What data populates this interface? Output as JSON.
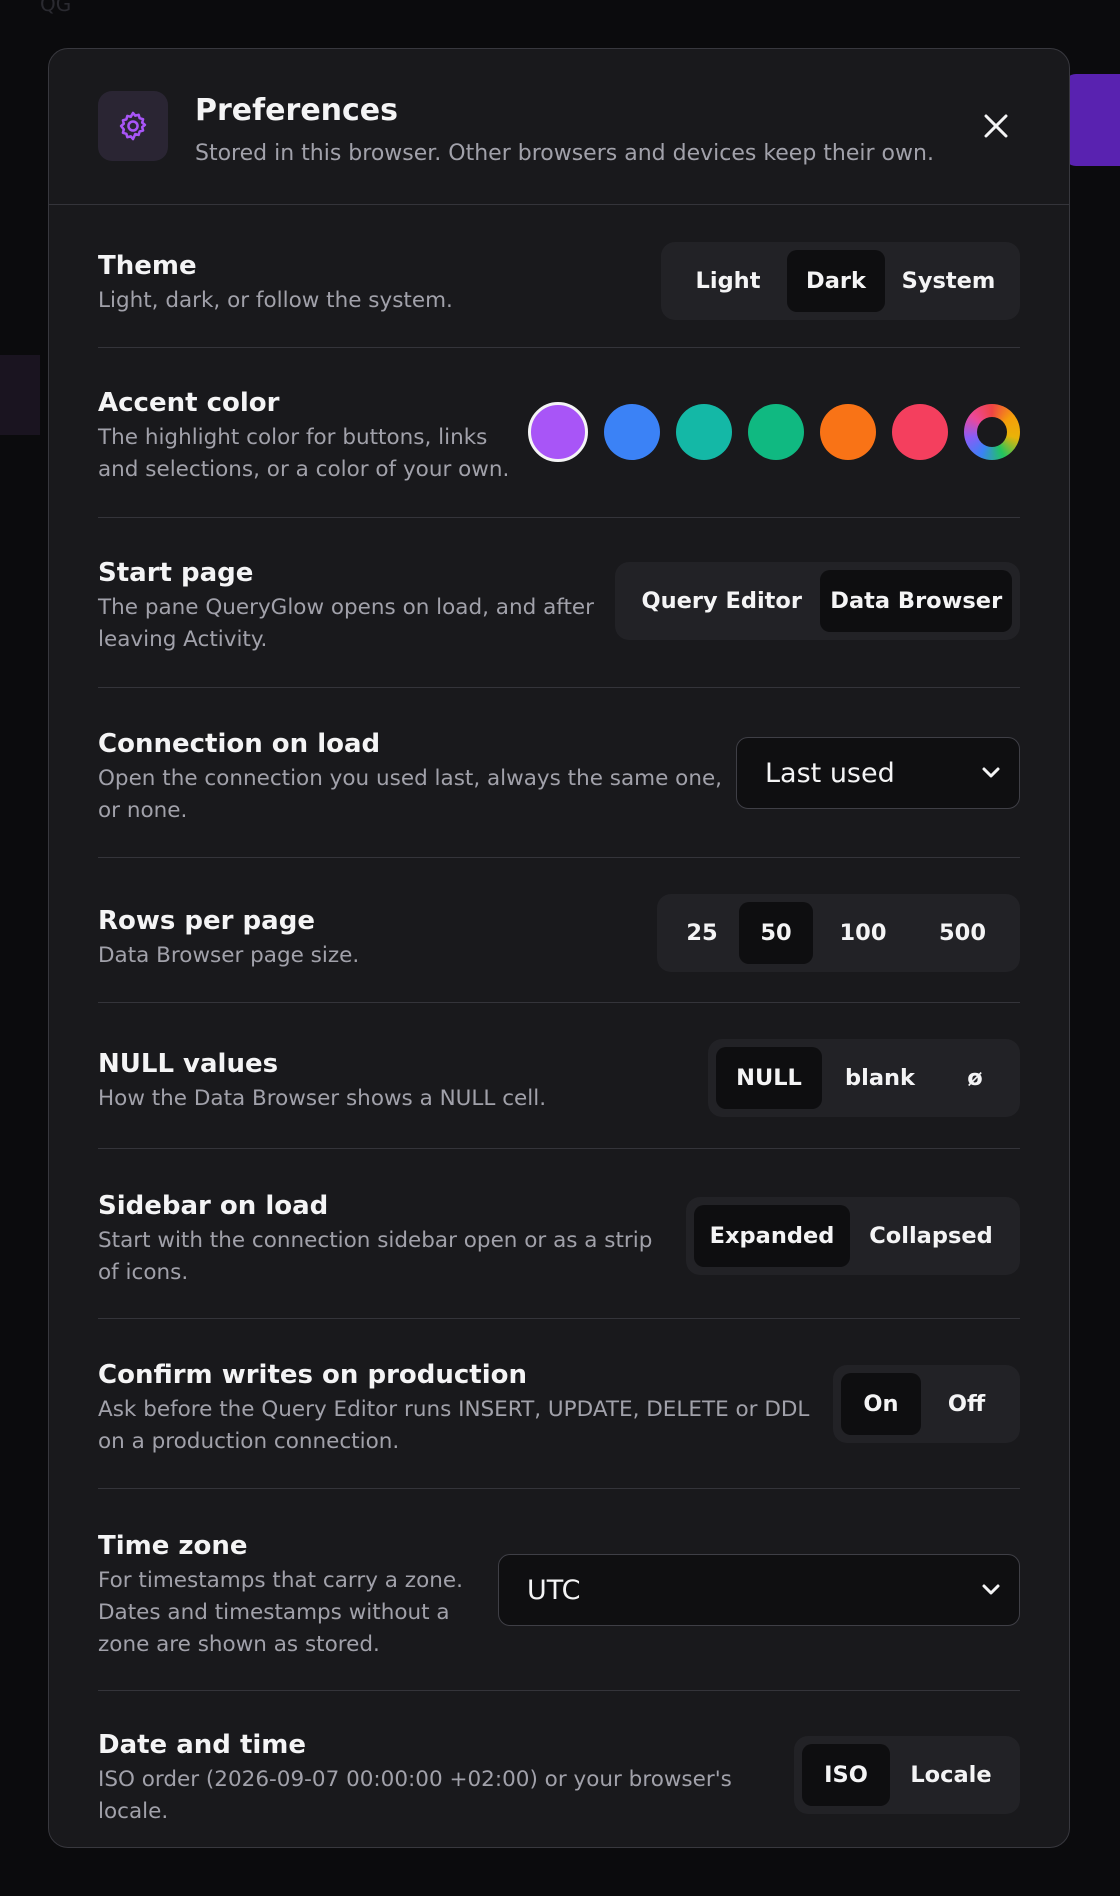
{
  "backdrop": {
    "top_left_text": "QG"
  },
  "dialog": {
    "title": "Preferences",
    "subtitle": "Stored in this browser. Other browsers and devices keep their own.",
    "header_icon": "gear-icon",
    "close_icon": "close-icon"
  },
  "settings": {
    "theme": {
      "title": "Theme",
      "description": "Light, dark, or follow the system.",
      "options": [
        "Light",
        "Dark",
        "System"
      ],
      "selected": "Dark"
    },
    "accent": {
      "title": "Accent color",
      "description_line1": "The highlight color for buttons, links",
      "description_line2": "and selections, or a color of your own.",
      "swatches": [
        "#a855f7",
        "#3b82f6",
        "#14b8a6",
        "#10b981",
        "#f97316",
        "#f43f5e"
      ],
      "selected": "#a855f7",
      "custom_icon": "color-wheel-icon"
    },
    "start_page": {
      "title": "Start page",
      "description_line1": "The pane QueryGlow opens on load, and after",
      "description_line2": "leaving Activity.",
      "options": [
        "Query Editor",
        "Data Browser"
      ],
      "selected": "Data Browser"
    },
    "connection": {
      "title": "Connection on load",
      "description_line1": "Open the connection you used last, always the same one,",
      "description_line2": "or none.",
      "value": "Last used"
    },
    "rows_per_page": {
      "title": "Rows per page",
      "description": "Data Browser page size.",
      "options": [
        "25",
        "50",
        "100",
        "500"
      ],
      "selected": "50"
    },
    "null_values": {
      "title": "NULL values",
      "description": "How the Data Browser shows a NULL cell.",
      "options": [
        "NULL",
        "blank",
        "ø"
      ],
      "selected": "NULL"
    },
    "sidebar": {
      "title": "Sidebar on load",
      "description_line1": "Start with the connection sidebar open or as a strip",
      "description_line2": "of icons.",
      "options": [
        "Expanded",
        "Collapsed"
      ],
      "selected": "Expanded"
    },
    "confirm_writes": {
      "title": "Confirm writes on production",
      "description_line1": "Ask before the Query Editor runs INSERT, UPDATE, DELETE or DDL",
      "description_line2": "on a production connection.",
      "options": [
        "On",
        "Off"
      ],
      "selected": "On"
    },
    "time_zone": {
      "title": "Time zone",
      "description_line1": "For timestamps that carry a zone.",
      "description_line2": "Dates and timestamps without a",
      "description_line3": "zone are shown as stored.",
      "value": "UTC"
    },
    "date_time": {
      "title": "Date and time",
      "description_line1": "ISO order (2026-09-07 00:00:00 +02:00) or your browser's",
      "description_line2": "locale.",
      "options": [
        "ISO",
        "Locale"
      ],
      "selected": "ISO"
    }
  }
}
